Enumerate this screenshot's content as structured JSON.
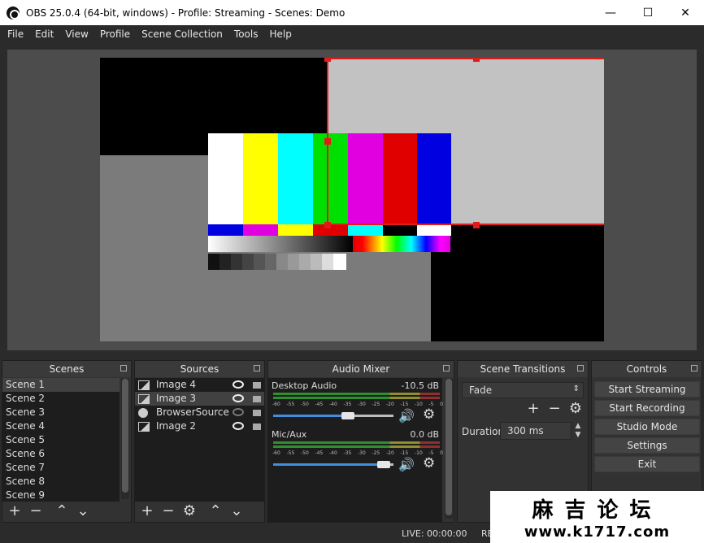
{
  "window": {
    "title": "OBS 25.0.4 (64-bit, windows) - Profile: Streaming - Scenes: Demo",
    "minimize_glyph": "—",
    "maximize_glyph": "☐",
    "close_glyph": "✕"
  },
  "menu": [
    "File",
    "Edit",
    "View",
    "Profile",
    "Scene Collection",
    "Tools",
    "Help"
  ],
  "docks": {
    "scenes": {
      "title": "Scenes",
      "items": [
        "Scene 1",
        "Scene 2",
        "Scene 3",
        "Scene 4",
        "Scene 5",
        "Scene 6",
        "Scene 7",
        "Scene 8",
        "Scene 9"
      ],
      "selected": 0
    },
    "sources": {
      "title": "Sources",
      "items": [
        {
          "label": "Image 4",
          "icon": "image-icon",
          "visible": true
        },
        {
          "label": "Image 3",
          "icon": "image-icon",
          "visible": true
        },
        {
          "label": "BrowserSource",
          "icon": "globe-icon",
          "visible": false
        },
        {
          "label": "Image 2",
          "icon": "image-icon",
          "visible": true
        }
      ],
      "selected": 1
    },
    "mixer": {
      "title": "Audio Mixer",
      "channels": [
        {
          "name": "Desktop Audio",
          "db": "-10.5 dB",
          "volume": 0.62
        },
        {
          "name": "Mic/Aux",
          "db": "0.0 dB",
          "volume": 0.95
        }
      ],
      "ticks": [
        "-60",
        "-55",
        "-50",
        "-45",
        "-40",
        "-35",
        "-30",
        "-25",
        "-20",
        "-15",
        "-10",
        "-5",
        "0"
      ]
    },
    "transitions": {
      "title": "Scene Transitions",
      "selected": "Fade",
      "duration_label": "Duration",
      "duration_value": "300 ms"
    },
    "controls": {
      "title": "Controls",
      "buttons": [
        "Start Streaming",
        "Start Recording",
        "Studio Mode",
        "Settings",
        "Exit"
      ]
    }
  },
  "status": {
    "live": "LIVE: 00:00:00",
    "rec": "RE"
  },
  "watermark": {
    "top": "麻吉论坛",
    "bottom": "www.k1717.com"
  },
  "colors": {
    "selection": "#e31a1a",
    "accent": "#3f8ee0"
  }
}
